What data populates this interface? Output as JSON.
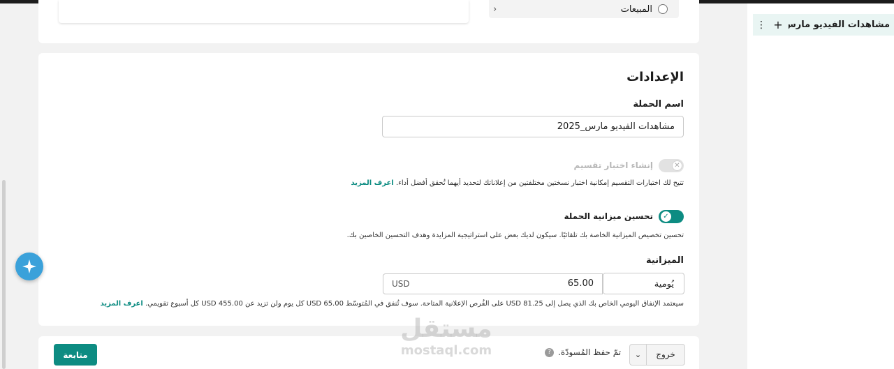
{
  "sidebar": {
    "campaign_name": "مشاهدات الفيديو مارس_...",
    "plus_glyph": "+",
    "more_glyph": "⋮"
  },
  "objective": {
    "sales_label": "المبيعات",
    "chevron_glyph": "‹"
  },
  "settings": {
    "title": "الإعدادات",
    "campaign_name_label": "اسم الحملة",
    "campaign_name_value": "مشاهدات الفيديو مارس_2025",
    "split_test": {
      "label": "إنشاء اختبار تقسيم",
      "description": "تتيح لك اختبارات التقسيم إمكانية اختبار نسختين مختلفتين من إعلاناتك لتحديد أيهما تُحقق أفضل أداء.",
      "link": "اعرف المزيد",
      "enabled": false
    },
    "budget_optimization": {
      "label": "تحسين ميزانية الحملة",
      "description": "تحسين تخصيص الميزانية الخاصة بك تلقائيًا. سيكون لديك بعض على استراتيجية المزايدة وهدف التحسين الخاصين بك.",
      "enabled": true
    },
    "budget": {
      "label": "الميزانية",
      "type": "يُومية",
      "amount": "65.00",
      "currency": "USD",
      "description": "سيعتمد الإنفاق اليومي الخاص بك الذي يصل إلى 81.25 USD على الفُرص الإعلانية المتاحة. سوف تُنفق في المُتوسّط 65.00 USD كل يوم ولن تزيد عن 455.00 USD كل أسبوع تقويمي.",
      "link": "اعرف المزيد"
    }
  },
  "footer": {
    "continue_label": "متابعة",
    "exit_label": "خروج",
    "dropdown_glyph": "⌄",
    "draft_status": "تمّ حفظ المُسودّة.",
    "help_glyph": "?"
  },
  "watermark": {
    "arabic": "مستقل",
    "latin": "mostaql.com"
  },
  "colors": {
    "accent": "#0d8c82",
    "fab": "#3aa1da"
  }
}
